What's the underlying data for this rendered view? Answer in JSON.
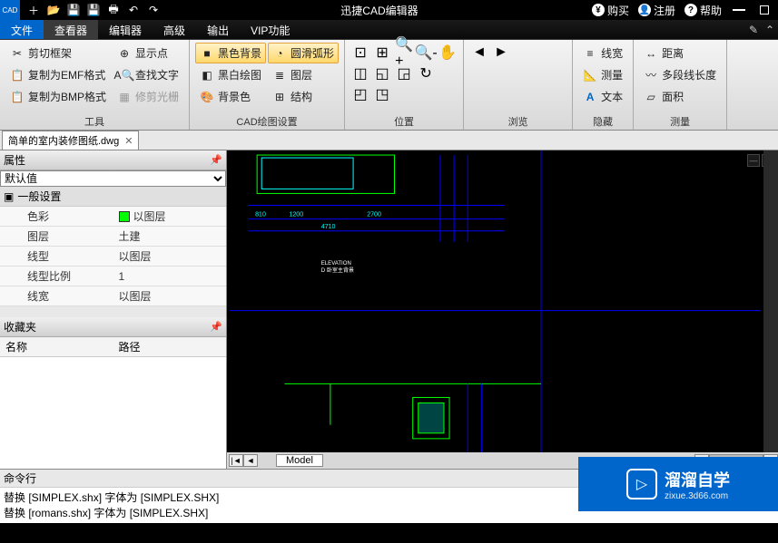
{
  "app": {
    "title": "迅捷CAD编辑器",
    "buy": "购买",
    "register": "注册",
    "help": "帮助"
  },
  "menus": {
    "file": "文件",
    "viewer": "查看器",
    "editor": "编辑器",
    "advanced": "高级",
    "output": "输出",
    "vip": "VIP功能"
  },
  "ribbon": {
    "tools": {
      "label": "工具",
      "clip_frame": "剪切框架",
      "copy_emf": "复制为EMF格式",
      "copy_bmp": "复制为BMP格式",
      "show_point": "显示点",
      "find_text": "查找文字",
      "fix_grid": "修剪光栅"
    },
    "cad": {
      "label": "CAD绘图设置",
      "black_bg": "黑色背景",
      "bw_draw": "黑白绘图",
      "bg_color": "背景色",
      "smooth_arc": "圆滑弧形",
      "layers": "图层",
      "structure": "结构"
    },
    "position": {
      "label": "位置"
    },
    "browse": {
      "label": "浏览"
    },
    "hide": {
      "label": "隐藏",
      "linew": "线宽",
      "measure": "测量",
      "text": "文本"
    },
    "measure": {
      "label": "测量",
      "distance": "距离",
      "polyline": "多段线长度",
      "area": "面积"
    }
  },
  "doc": {
    "name": "简单的室内装修图纸.dwg"
  },
  "props": {
    "title": "属性",
    "default": "默认值",
    "general": "一般设置",
    "color_k": "色彩",
    "color_v": "以图层",
    "layer_k": "图层",
    "layer_v": "土建",
    "ltype_k": "线型",
    "ltype_v": "以图层",
    "lscale_k": "线型比例",
    "lscale_v": "1",
    "lwidth_k": "线宽",
    "lwidth_v": "以图层"
  },
  "fav": {
    "title": "收藏夹",
    "name": "名称",
    "path": "路径"
  },
  "drawing_labels": {
    "dim1": "810",
    "dim2": "1200",
    "dim3": "2700",
    "dim_total": "4710",
    "elevation": "ELEVATION",
    "sub": "D 卧室主背景"
  },
  "model": {
    "tab": "Model"
  },
  "cmd": {
    "title": "命令行",
    "l1": "替换 [SIMPLEX.shx] 字体为 [SIMPLEX.SHX]",
    "l2": "替换 [romans.shx] 字体为 [SIMPLEX.SHX]"
  },
  "watermark": {
    "brand": "溜溜自学",
    "url": "zixue.3d66.com"
  }
}
